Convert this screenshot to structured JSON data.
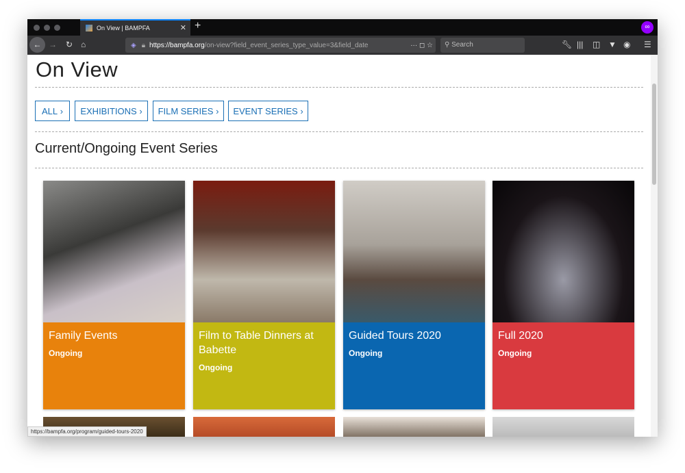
{
  "browser": {
    "tab_title": "On View | BAMPFA",
    "url_host": "https://bampfa.org",
    "url_path": "/on-view?field_event_series_type_value=3&field_date",
    "search_placeholder": "Search",
    "status_url": "https://bampfa.org/program/guided-tours-2020"
  },
  "page": {
    "title": "On View",
    "filters": [
      "ALL",
      "EXHIBITIONS",
      "FILM SERIES",
      "EVENT SERIES"
    ],
    "section_title": "Current/Ongoing Event Series"
  },
  "cards": [
    {
      "title": "Family Events",
      "status": "Ongoing",
      "color": "#e8820c"
    },
    {
      "title": "Film to Table Dinners at Babette",
      "status": "Ongoing",
      "color": "#c2b812"
    },
    {
      "title": "Guided Tours 2020",
      "status": "Ongoing",
      "color": "#0a66b0"
    },
    {
      "title": "Full 2020",
      "status": "Ongoing",
      "color": "#d93a3f"
    }
  ]
}
